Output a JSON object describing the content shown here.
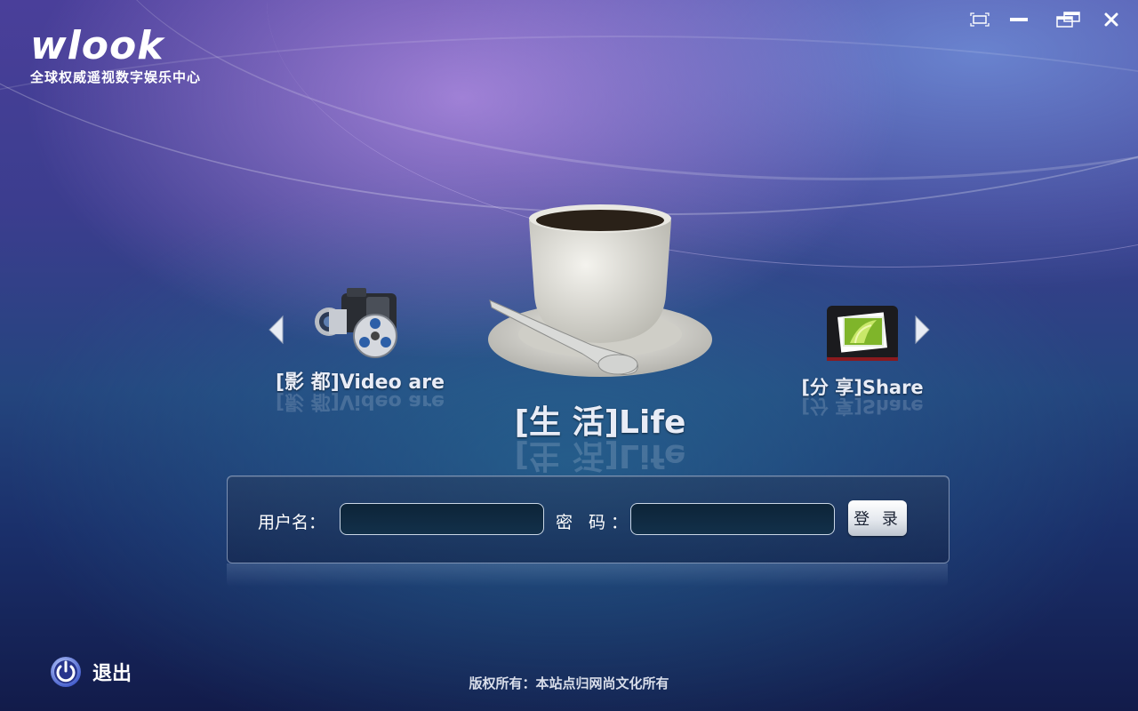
{
  "app": {
    "logo": "wlook",
    "tagline": "全球权威遥视数字娱乐中心"
  },
  "window_controls": {
    "fullscreen_icon": "fullscreen-icon",
    "minimize_icon": "minimize-icon",
    "restore_icon": "restore-icon",
    "close_icon": "close-icon"
  },
  "carousel": {
    "left_item": {
      "label": "[影 都]Video are",
      "icon": "camcorder-icon"
    },
    "center_item": {
      "label": "[生 活]Life",
      "icon": "coffee-cup-icon"
    },
    "right_item": {
      "label": "[分 享]Share",
      "icon": "photo-album-icon"
    }
  },
  "login": {
    "username_label": "用户名：",
    "username_value": "",
    "password_label": "密 码：",
    "password_value": "",
    "submit_label": "登 录"
  },
  "exit": {
    "label": "退出",
    "icon": "power-icon"
  },
  "footer": {
    "copyright": "版权所有：本站点归网尚文化所有"
  }
}
